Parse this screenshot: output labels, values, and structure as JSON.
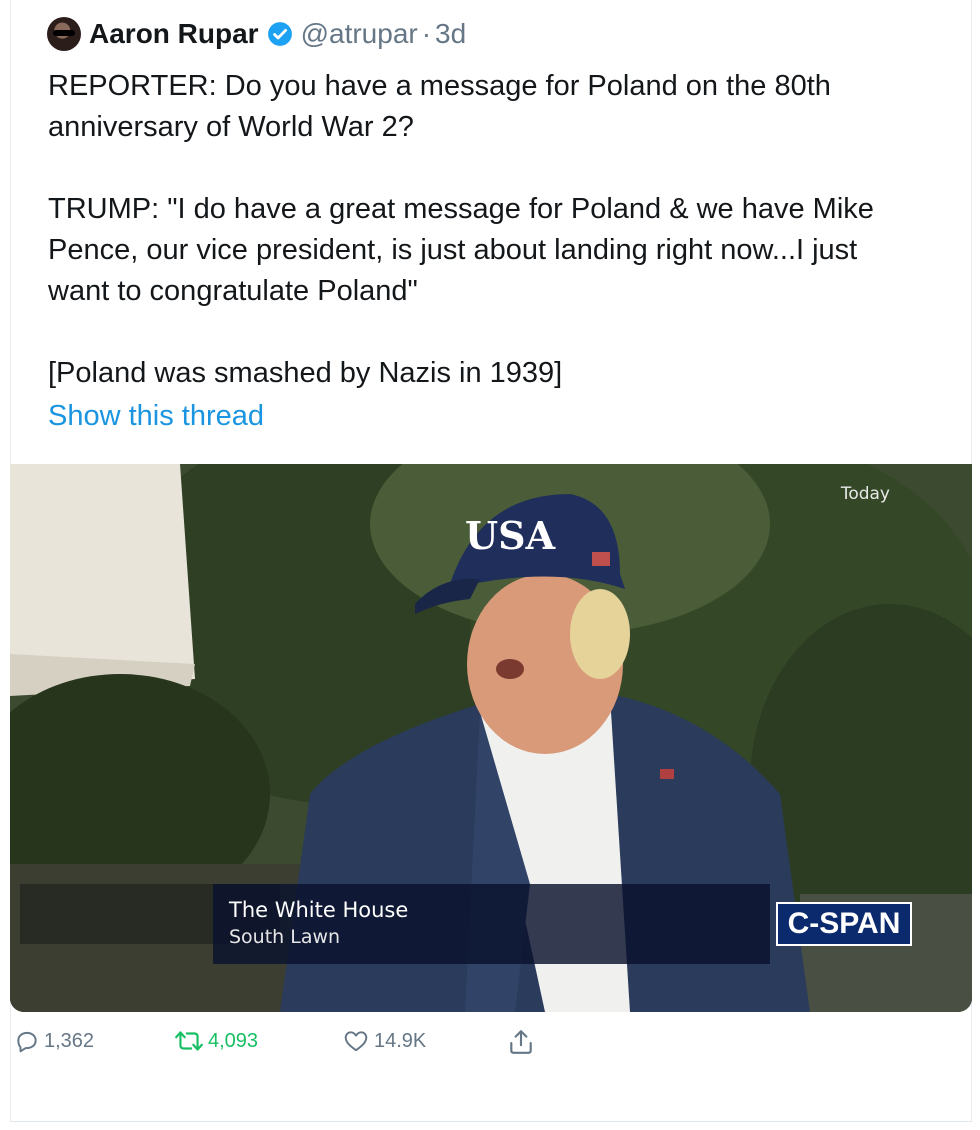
{
  "tweet": {
    "author_name": "Aaron Rupar",
    "handle": "@atrupar",
    "separator": "·",
    "time": "3d",
    "text": "REPORTER: Do you have a message for Poland on the 80th\nanniversary of World War 2?\n\nTRUMP: \"I do have a great message for Poland & we have Mike\nPence, our vice president, is just about landing right now...I just\nwant to congratulate Poland\"\n\n[Poland was smashed by Nazis in 1939]",
    "thread_link": "Show this thread"
  },
  "media": {
    "corner_label": "Today",
    "cap_text": "USA",
    "lower_third_line1": "The White House",
    "lower_third_line2": "South Lawn",
    "network_logo": "C-SPAN"
  },
  "actions": {
    "replies": "1,362",
    "retweets": "4,093",
    "likes": "14.9K"
  },
  "icons": [
    "verified-badge-icon",
    "reply-icon",
    "retweet-icon",
    "like-icon",
    "share-icon"
  ],
  "colors": {
    "link": "#1b95e0",
    "retweet": "#17bf63",
    "muted": "#657786",
    "verified": "#1da1f2"
  }
}
